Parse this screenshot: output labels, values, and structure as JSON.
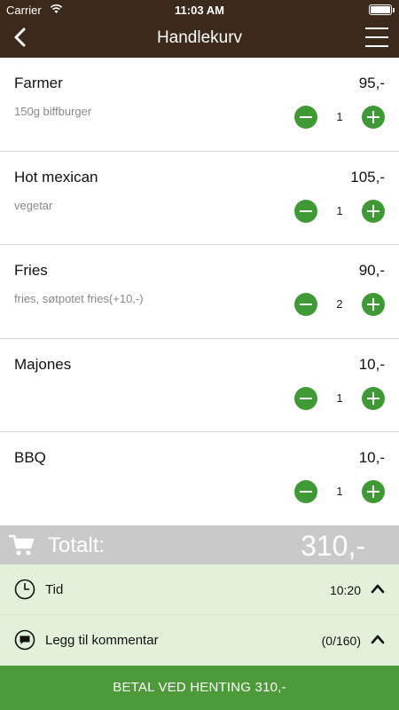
{
  "status_bar": {
    "carrier": "Carrier",
    "time": "11:03 AM"
  },
  "nav": {
    "title": "Handlekurv"
  },
  "items": [
    {
      "name": "Farmer",
      "description": "150g biffburger",
      "price": "95,-",
      "quantity": "1"
    },
    {
      "name": "Hot mexican",
      "description": "vegetar",
      "price": "105,-",
      "quantity": "1"
    },
    {
      "name": "Fries",
      "description": "fries, søtpotet fries(+10,-)",
      "price": "90,-",
      "quantity": "2"
    },
    {
      "name": "Majones",
      "description": "",
      "price": "10,-",
      "quantity": "1"
    },
    {
      "name": "BBQ",
      "description": "",
      "price": "10,-",
      "quantity": "1"
    }
  ],
  "total": {
    "label": "Totalt:",
    "amount": "310,-"
  },
  "options": {
    "time": {
      "label": "Tid",
      "value": "10:20"
    },
    "comment": {
      "label": "Legg til kommentar",
      "value": "(0/160)"
    }
  },
  "pay_button": {
    "label": "BETAL VED HENTING 310,-"
  },
  "colors": {
    "header": "#3b2a1c",
    "accent_green": "#3f9a36",
    "pay_green": "#4c9a3a",
    "option_bg": "#e3f1db",
    "total_bar": "#c9c9c9"
  },
  "icons": {
    "back": "chevron-left-icon",
    "menu": "hamburger-menu-icon",
    "cart": "shopping-cart-icon",
    "clock": "clock-icon",
    "comment": "speech-bubble-icon",
    "expand": "chevron-up-icon"
  }
}
